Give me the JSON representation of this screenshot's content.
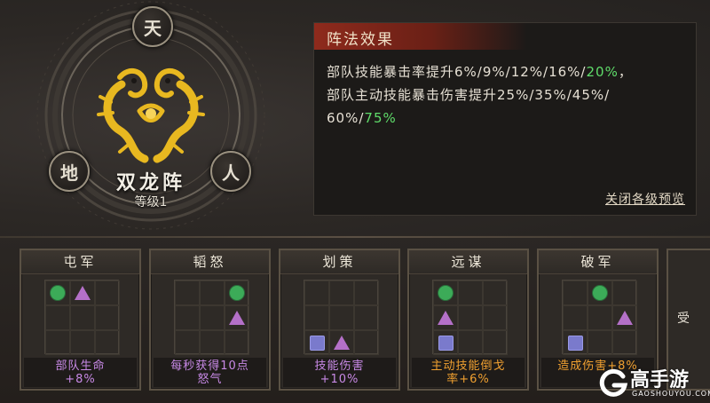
{
  "formation": {
    "name": "双龙阵",
    "level": "等级1",
    "nodes": {
      "top": "天",
      "left": "地",
      "right": "人"
    }
  },
  "effect": {
    "title": "阵法效果",
    "line1_prefix": "部队技能暴击率提升6%/9%/12%/16%/",
    "line1_highlight": "20%",
    "line1_suffix": "，",
    "line2_prefix": "部队主动技能暴击伤害提升25%/35%/45%/",
    "line3_prefix": "60%/",
    "line3_highlight": "75%",
    "close_link": "关闭各级预览"
  },
  "cards": [
    {
      "title": "屯军",
      "desc": "部队生命\n+8%",
      "desc_color": "purple",
      "cells": [
        "circle",
        "triangle",
        "",
        "",
        "",
        "",
        "",
        "",
        ""
      ]
    },
    {
      "title": "韬怒",
      "desc": "每秒获得10点\n怒气",
      "desc_color": "purple",
      "cells": [
        "",
        "",
        "circle",
        "",
        "",
        "triangle",
        "",
        "",
        ""
      ]
    },
    {
      "title": "划策",
      "desc": "技能伤害\n+10%",
      "desc_color": "purple",
      "cells": [
        "",
        "",
        "",
        "",
        "",
        "",
        "square",
        "triangle",
        ""
      ]
    },
    {
      "title": "远谋",
      "desc": "主动技能倒戈\n率+6%",
      "desc_color": "orange",
      "cells": [
        "circle",
        "",
        "",
        "triangle",
        "",
        "",
        "square",
        "",
        ""
      ]
    },
    {
      "title": "破军",
      "desc": "造成伤害+8%",
      "desc_color": "orange",
      "cells": [
        "",
        "circle",
        "",
        "",
        "",
        "triangle",
        "square",
        "",
        ""
      ]
    }
  ],
  "partial_card": {
    "text": "受"
  },
  "watermark": {
    "brand": "高手游",
    "url": "GAOSHOUYOU.COM"
  },
  "colors": {
    "highlight_green": "#5fdc6a",
    "desc_purple": "#c889e6",
    "desc_orange": "#f0a030",
    "header_red": "#8e2a1c",
    "dragon_gold": "#e8b820"
  }
}
